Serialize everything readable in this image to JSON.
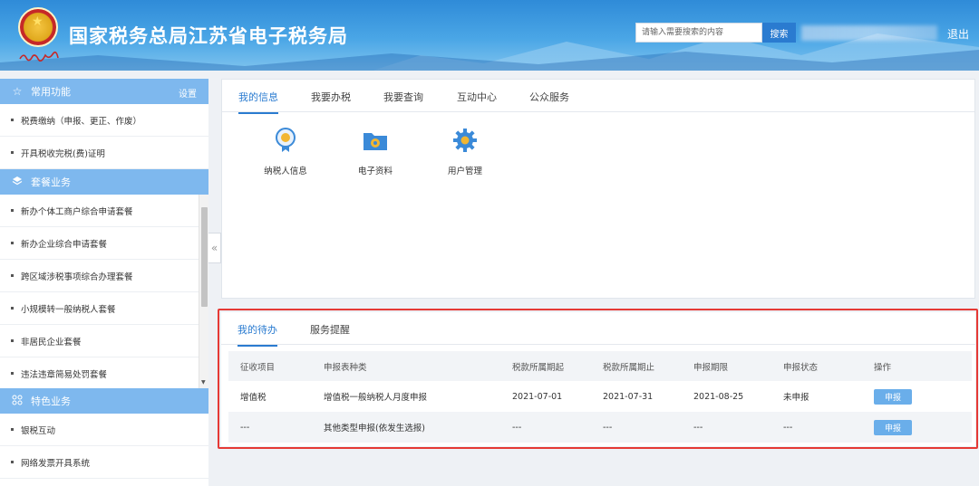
{
  "header": {
    "site_title": "国家税务总局江苏省电子税务局",
    "search_placeholder": "请输入需要搜索的内容",
    "search_button": "搜索",
    "logout": "退出"
  },
  "sidebar": {
    "common": {
      "title": "常用功能",
      "setting": "设置",
      "items": [
        "税费缴纳（申报、更正、作废）",
        "开具税收完税(费)证明"
      ]
    },
    "package": {
      "title": "套餐业务",
      "items": [
        "新办个体工商户综合申请套餐",
        "新办企业综合申请套餐",
        "跨区域涉税事项综合办理套餐",
        "小规模转一般纳税人套餐",
        "非居民企业套餐",
        "违法违章简易处罚套餐"
      ]
    },
    "special": {
      "title": "特色业务",
      "items": [
        "银税互动",
        "网络发票开具系统"
      ]
    }
  },
  "panel_info": {
    "tabs": [
      "我的信息",
      "我要办税",
      "我要查询",
      "互动中心",
      "公众服务"
    ],
    "active_tab": 0,
    "tiles": [
      {
        "label": "纳税人信息",
        "icon": "taxpayer-info-icon"
      },
      {
        "label": "电子资料",
        "icon": "folder-icon"
      },
      {
        "label": "用户管理",
        "icon": "gear-icon"
      }
    ]
  },
  "panel_todo": {
    "tabs": [
      "我的待办",
      "服务提醒"
    ],
    "active_tab": 0,
    "columns": [
      "征收项目",
      "申报表种类",
      "税款所属期起",
      "税款所属期止",
      "申报期限",
      "申报状态",
      "操作"
    ],
    "rows": [
      [
        "增值税",
        "增值税一般纳税人月度申报",
        "2021-07-01",
        "2021-07-31",
        "2021-08-25",
        "未申报",
        "申报"
      ],
      [
        "---",
        "其他类型申报(依发生选报)",
        "---",
        "---",
        "---",
        "---",
        "申报"
      ]
    ]
  },
  "colors": {
    "accent": "#2a7bd0",
    "sidebar_header": "#7eb8ee",
    "highlight_border": "#e53935",
    "button": "#6aaeea"
  }
}
